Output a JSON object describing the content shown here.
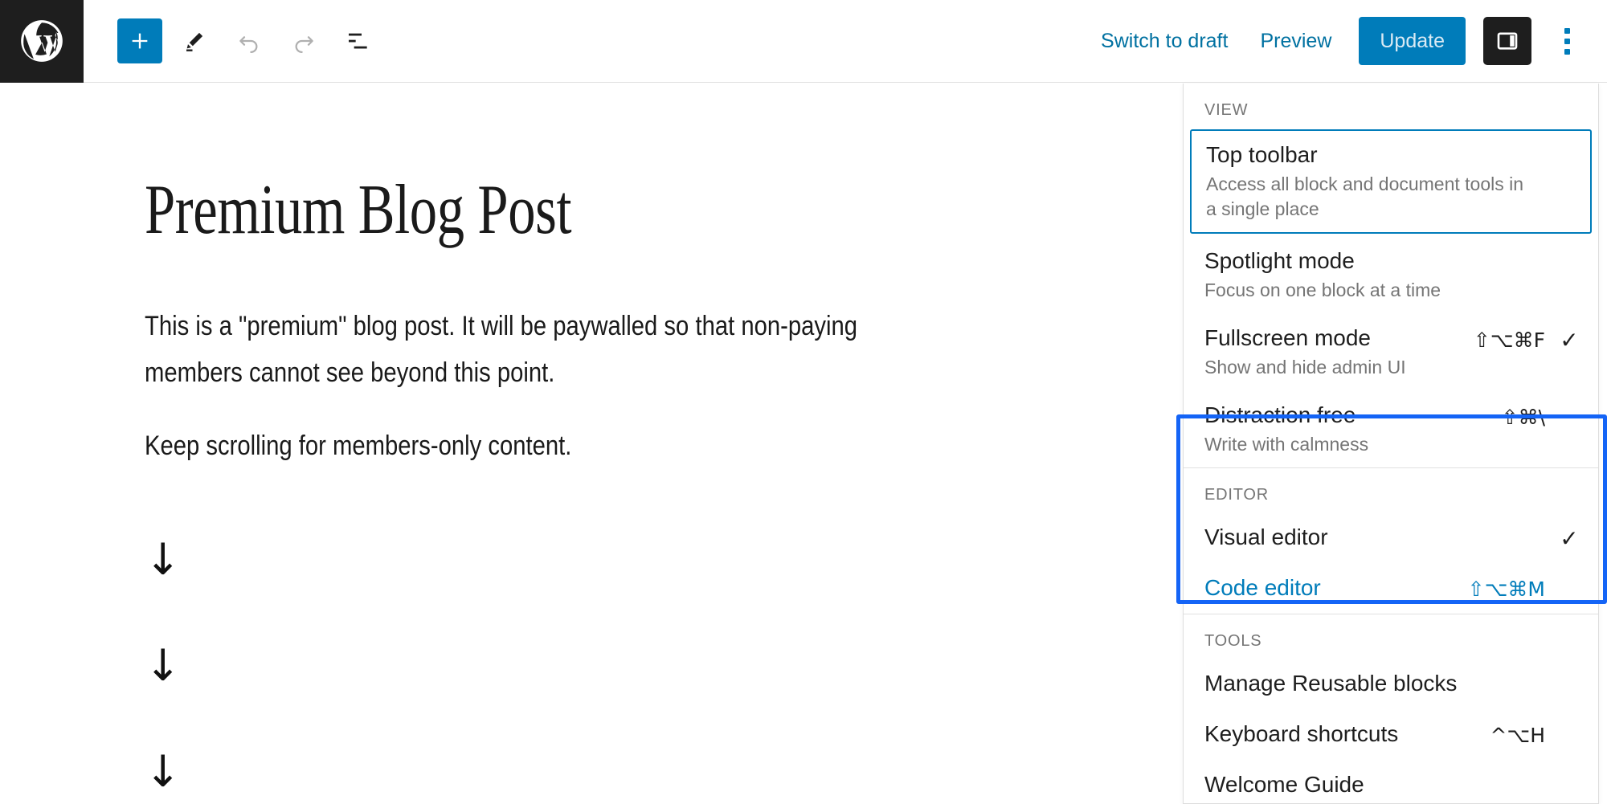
{
  "toolbar": {
    "wp_logo_name": "wordpress-logo",
    "add_block_label": "+",
    "tools": [
      {
        "name": "add-block-button",
        "label": "Add block"
      },
      {
        "name": "edit-tool-button",
        "label": "Tools"
      },
      {
        "name": "undo-button",
        "label": "Undo"
      },
      {
        "name": "redo-button",
        "label": "Redo"
      },
      {
        "name": "list-view-button",
        "label": "List view"
      }
    ],
    "switch_to_draft": "Switch to draft",
    "preview": "Preview",
    "update": "Update",
    "settings_toggle_name": "settings-sidebar-icon",
    "kebab_name": "more-options-icon"
  },
  "post": {
    "title": "Premium Blog Post",
    "paragraph_1": "This is a \"premium\" blog post. It will be paywalled so that non-paying members cannot see beyond this point.",
    "paragraph_2": "Keep scrolling for members-only content.",
    "arrow_1": "↓",
    "arrow_2": "↓",
    "arrow_3": "↓"
  },
  "more_menu": {
    "groups": [
      {
        "label": "VIEW",
        "items": [
          {
            "title": "Top toolbar",
            "desc": "Access all block and document tools in a single place",
            "shortcut": "",
            "checked": false,
            "focused": true,
            "is_link": false
          },
          {
            "title": "Spotlight mode",
            "desc": "Focus on one block at a time",
            "shortcut": "",
            "checked": false,
            "focused": false,
            "is_link": false
          },
          {
            "title": "Fullscreen mode",
            "desc": "Show and hide admin UI",
            "shortcut": "⇧⌥⌘F",
            "checked": true,
            "focused": false,
            "is_link": false
          },
          {
            "title": "Distraction free",
            "desc": "Write with calmness",
            "shortcut": "⇧⌘\\",
            "checked": false,
            "focused": false,
            "is_link": false
          }
        ]
      },
      {
        "label": "EDITOR",
        "items": [
          {
            "title": "Visual editor",
            "desc": "",
            "shortcut": "",
            "checked": true,
            "focused": false,
            "is_link": false
          },
          {
            "title": "Code editor",
            "desc": "",
            "shortcut": "⇧⌥⌘M",
            "checked": false,
            "focused": false,
            "is_link": true
          }
        ]
      },
      {
        "label": "TOOLS",
        "items": [
          {
            "title": "Manage Reusable blocks",
            "desc": "",
            "shortcut": "",
            "checked": false,
            "focused": false,
            "is_link": false
          },
          {
            "title": "Keyboard shortcuts",
            "desc": "",
            "shortcut": "^⌥H",
            "checked": false,
            "focused": false,
            "is_link": false
          },
          {
            "title": "Welcome Guide",
            "desc": "",
            "shortcut": "",
            "checked": false,
            "focused": false,
            "is_link": false
          }
        ]
      }
    ]
  },
  "colors": {
    "accent": "#007cba",
    "link": "#0071a1",
    "annotation": "#1464f6",
    "dark": "#1e1e1e",
    "muted": "#757575"
  }
}
